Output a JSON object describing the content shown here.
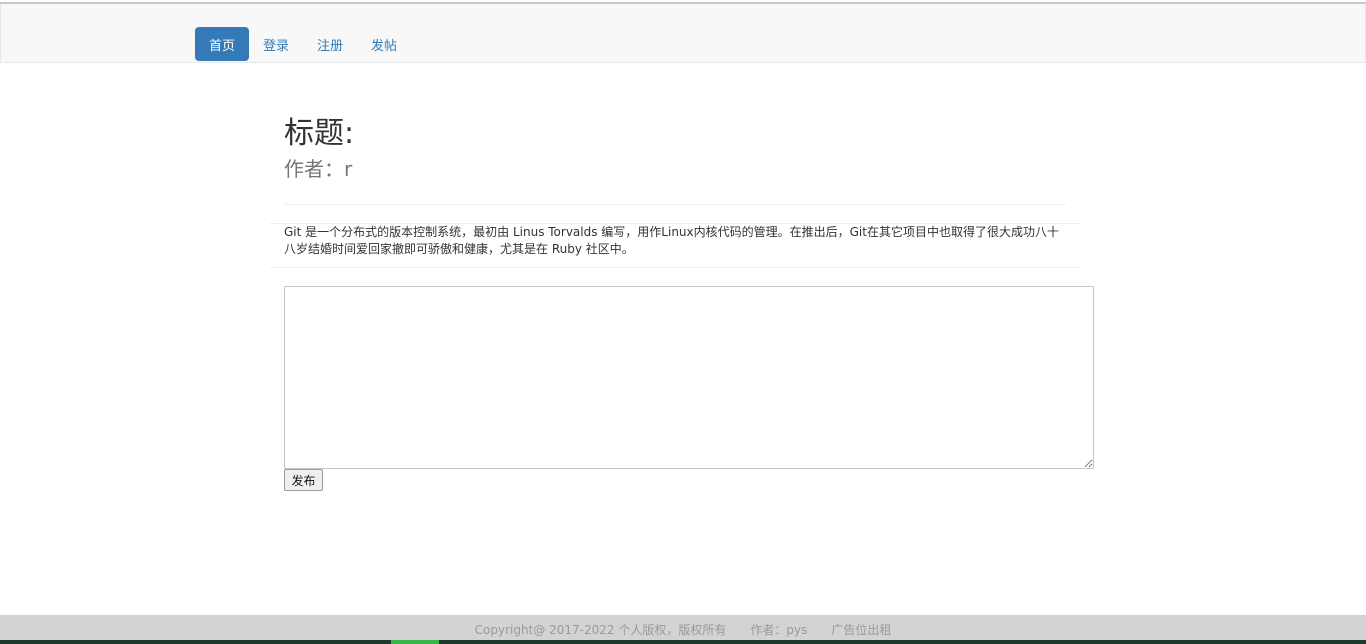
{
  "nav": {
    "items": [
      {
        "label": "首页",
        "active": true
      },
      {
        "label": "登录",
        "active": false
      },
      {
        "label": "注册",
        "active": false
      },
      {
        "label": "发帖",
        "active": false
      }
    ]
  },
  "post": {
    "title": "标题:",
    "author": "作者：r",
    "content": "Git 是一个分布式的版本控制系统，最初由 Linus Torvalds 编写，用作Linux内核代码的管理。在推出后，Git在其它项目中也取得了很大成功八十八岁结婚时间爱回家撤即可骄傲和健康，尤其是在 Ruby 社区中。"
  },
  "reply": {
    "value": "",
    "submit_label": "发布"
  },
  "footer": {
    "copyright": "Copyright@ 2017-2022 个人版权，版权所有",
    "author": "作者：pys",
    "ad": "广告位出租"
  },
  "colors": {
    "accent": "#337ab7",
    "navbar_bg": "#f8f8f8",
    "footer_bg": "#d3d3d3"
  }
}
